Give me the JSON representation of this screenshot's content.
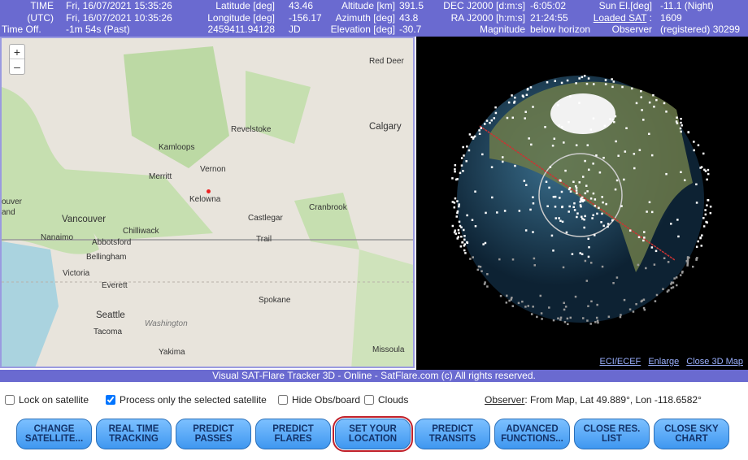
{
  "header": {
    "time_label": "TIME",
    "time_value": "Fri, 16/07/2021 15:35:26",
    "utc_label": "(UTC)",
    "utc_value": "Fri, 16/07/2021 10:35:26",
    "offset_label": "Time Off.",
    "offset_value": "-1m 54s (Past)",
    "lat_label": "Latitude [deg]",
    "lat_value": "43.46",
    "lon_label": "Longitude [deg]",
    "lon_value": "-156.17",
    "jd_value": "2459411.94128",
    "jd_label": "JD",
    "alt_label": "Altitude [km]",
    "alt_value": "391.5",
    "az_label": "Azimuth [deg]",
    "az_value": "43.8",
    "el_label": "Elevation [deg]",
    "el_value": "-30.7",
    "dec_label": "DEC J2000 [d:m:s]",
    "dec_value": "-6:05:02",
    "ra_label": "RA J2000 [h:m:s]",
    "ra_value": "21:24:55",
    "mag_label": "Magnitude",
    "mag_value": "below horizon",
    "sun_label": "Sun El.[deg]",
    "sun_value": "-11.1 (Night)",
    "loaded_label": "Loaded SAT",
    "loaded_sep": ":",
    "loaded_value": "1609",
    "observer_label": "Observer",
    "observer_value": "(registered) 30299"
  },
  "map": {
    "zoom_in": "+",
    "zoom_out": "–",
    "labels": [
      "Red Deer",
      "Revelstoke",
      "Calgary",
      "Kamloops",
      "Vernon",
      "Merritt",
      "Kelowna",
      "Cranbrook",
      "Castlegar",
      "Trail",
      "Vancouver",
      "Chilliwack",
      "Nanaimo",
      "Abbotsford",
      "Bellingham",
      "Victoria",
      "Everett",
      "Seattle",
      "Tacoma",
      "Spokane",
      "Washington",
      "Yakima",
      "Missoula",
      "ouver",
      "and"
    ]
  },
  "globe": {
    "links": [
      "ECI/ECEF",
      "Enlarge",
      "Close 3D Map"
    ]
  },
  "footer": "Visual SAT-Flare Tracker 3D - Online - SatFlare.com (c) All rights reserved.",
  "options": [
    {
      "label": "Lock on satellite",
      "checked": false
    },
    {
      "label": "Process only the selected satellite",
      "checked": true
    },
    {
      "label": "Hide Obs/board",
      "checked": false
    },
    {
      "label": "Clouds",
      "checked": false
    }
  ],
  "observer": {
    "link": "Observer",
    "text": ": From Map, Lat 49.889°, Lon -118.6582°"
  },
  "buttons": [
    {
      "l1": "CHANGE",
      "l2": "SATELLITE..."
    },
    {
      "l1": "REAL TIME",
      "l2": "TRACKING"
    },
    {
      "l1": "PREDICT",
      "l2": "PASSES"
    },
    {
      "l1": "PREDICT",
      "l2": "FLARES"
    },
    {
      "l1": "SET YOUR",
      "l2": "LOCATION",
      "selected": true
    },
    {
      "l1": "PREDICT",
      "l2": "TRANSITS"
    },
    {
      "l1": "ADVANCED",
      "l2": "FUNCTIONS..."
    },
    {
      "l1": "CLOSE RES.",
      "l2": "LIST"
    },
    {
      "l1": "CLOSE SKY",
      "l2": "CHART"
    }
  ],
  "colors": {
    "header_bg": "#6a6ad0",
    "button": "#4fa4f5",
    "selected_outline": "#c0202a"
  }
}
